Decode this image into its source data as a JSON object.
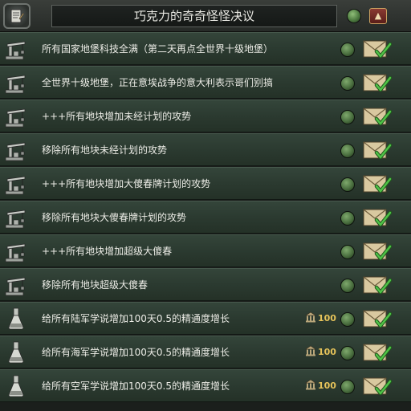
{
  "header": {
    "title": "巧克力的奇奇怪怪决议",
    "icon": "decision-scroll-icon",
    "collapse_icon": "chevron-up-icon"
  },
  "colors": {
    "row_bg": "#2f4035",
    "text": "#ecece6",
    "cost": "#e6c35a",
    "accept_check": "#3fa83a"
  },
  "decisions": [
    {
      "label": "所有国家地堡科技全满（第二天再点全世界十级地堡）",
      "icon": "crane-icon"
    },
    {
      "label": "全世界十级地堡，正在意埃战争的意大利表示哥们别搞",
      "icon": "crane-icon"
    },
    {
      "label": "+++所有地块增加未经计划的攻势",
      "icon": "crane-icon"
    },
    {
      "label": "移除所有地块未经计划的攻势",
      "icon": "crane-icon"
    },
    {
      "label": "+++所有地块增加大傻春牌计划的攻势",
      "icon": "crane-icon"
    },
    {
      "label": "移除所有地块大傻春牌计划的攻势",
      "icon": "crane-icon"
    },
    {
      "label": "+++所有地块增加超级大傻春",
      "icon": "crane-icon"
    },
    {
      "label": "移除所有地块超级大傻春",
      "icon": "crane-icon"
    },
    {
      "label": "给所有陆军学说增加100天0.5的精通度增长",
      "icon": "flask-icon",
      "cost": "100"
    },
    {
      "label": "给所有海军学说增加100天0.5的精通度增长",
      "icon": "flask-icon",
      "cost": "100"
    },
    {
      "label": "给所有空军学说增加100天0.5的精通度增长",
      "icon": "flask-icon",
      "cost": "100"
    }
  ]
}
